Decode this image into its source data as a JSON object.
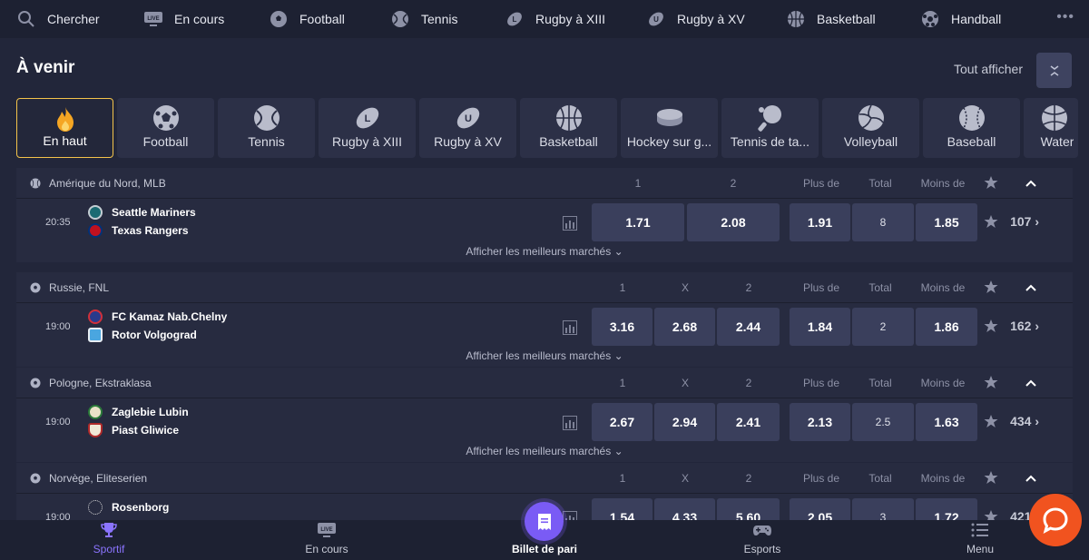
{
  "topnav": {
    "items": [
      {
        "label": "Chercher",
        "icon": "search-icon"
      },
      {
        "label": "En cours",
        "icon": "live-tv-icon"
      },
      {
        "label": "Football",
        "icon": "football-icon"
      },
      {
        "label": "Tennis",
        "icon": "tennis-icon"
      },
      {
        "label": "Rugby à XIII",
        "icon": "rugby-league-icon"
      },
      {
        "label": "Rugby à XV",
        "icon": "rugby-union-icon"
      },
      {
        "label": "Basketball",
        "icon": "basketball-icon"
      },
      {
        "label": "Handball",
        "icon": "handball-icon"
      }
    ],
    "more": "•••"
  },
  "upcoming": {
    "title": "À venir",
    "show_all": "Tout afficher"
  },
  "sports": [
    {
      "label": "En haut",
      "icon": "fire-icon",
      "active": true
    },
    {
      "label": "Football",
      "icon": "football-icon"
    },
    {
      "label": "Tennis",
      "icon": "tennis-icon"
    },
    {
      "label": "Rugby à XIII",
      "icon": "rugby-league-icon"
    },
    {
      "label": "Rugby à XV",
      "icon": "rugby-union-icon"
    },
    {
      "label": "Basketball",
      "icon": "basketball-icon"
    },
    {
      "label": "Hockey sur g...",
      "icon": "hockey-puck-icon"
    },
    {
      "label": "Tennis de ta...",
      "icon": "table-tennis-icon"
    },
    {
      "label": "Volleyball",
      "icon": "volleyball-icon"
    },
    {
      "label": "Baseball",
      "icon": "baseball-icon"
    },
    {
      "label": "Water",
      "icon": "waterpolo-icon"
    }
  ],
  "best_markets_label": "Afficher les meilleurs marchés",
  "leagues": [
    {
      "name": "Amérique du Nord, MLB",
      "sport_icon": "baseball-icon",
      "cols": [
        "1",
        "2",
        "Plus de",
        "Total",
        "Moins de"
      ],
      "match": {
        "time": "20:35",
        "home": "Seattle Mariners",
        "away": "Texas Rangers",
        "odds": [
          "1.71",
          "2.08"
        ],
        "over": "1.91",
        "total": "8",
        "under": "1.85",
        "markets": "107"
      }
    },
    {
      "name": "Russie, FNL",
      "sport_icon": "football-icon",
      "cols": [
        "1",
        "X",
        "2",
        "Plus de",
        "Total",
        "Moins de"
      ],
      "match": {
        "time": "19:00",
        "home": "FC Kamaz Nab.Chelny",
        "away": "Rotor Volgograd",
        "odds": [
          "3.16",
          "2.68",
          "2.44"
        ],
        "over": "1.84",
        "total": "2",
        "under": "1.86",
        "markets": "162"
      }
    },
    {
      "name": "Pologne, Ekstraklasa",
      "sport_icon": "football-icon",
      "cols": [
        "1",
        "X",
        "2",
        "Plus de",
        "Total",
        "Moins de"
      ],
      "match": {
        "time": "19:00",
        "home": "Zaglebie Lubin",
        "away": "Piast Gliwice",
        "odds": [
          "2.67",
          "2.94",
          "2.41"
        ],
        "over": "2.13",
        "total": "2.5",
        "under": "1.63",
        "markets": "434"
      }
    },
    {
      "name": "Norvège, Eliteserien",
      "sport_icon": "football-icon",
      "cols": [
        "1",
        "X",
        "2",
        "Plus de",
        "Total",
        "Moins de"
      ],
      "match": {
        "time": "19:00",
        "home": "Rosenborg",
        "away": "",
        "odds": [
          "1.54",
          "4.33",
          "5.60"
        ],
        "over": "2.05",
        "total": "3",
        "under": "1.72",
        "markets": "421"
      }
    }
  ],
  "bottomnav": [
    {
      "label": "Sportif",
      "icon": "trophy-icon",
      "active": true
    },
    {
      "label": "En cours",
      "icon": "live-tv-icon"
    },
    {
      "label": "Billet de pari",
      "icon": "betslip-icon"
    },
    {
      "label": "Esports",
      "icon": "gamepad-icon"
    },
    {
      "label": "Menu",
      "icon": "menu-icon"
    }
  ],
  "colors": {
    "accent": "#8b74ff",
    "active_border": "#f4c34a",
    "chat": "#f1531f",
    "odd_bg": "#3a3f5c"
  }
}
